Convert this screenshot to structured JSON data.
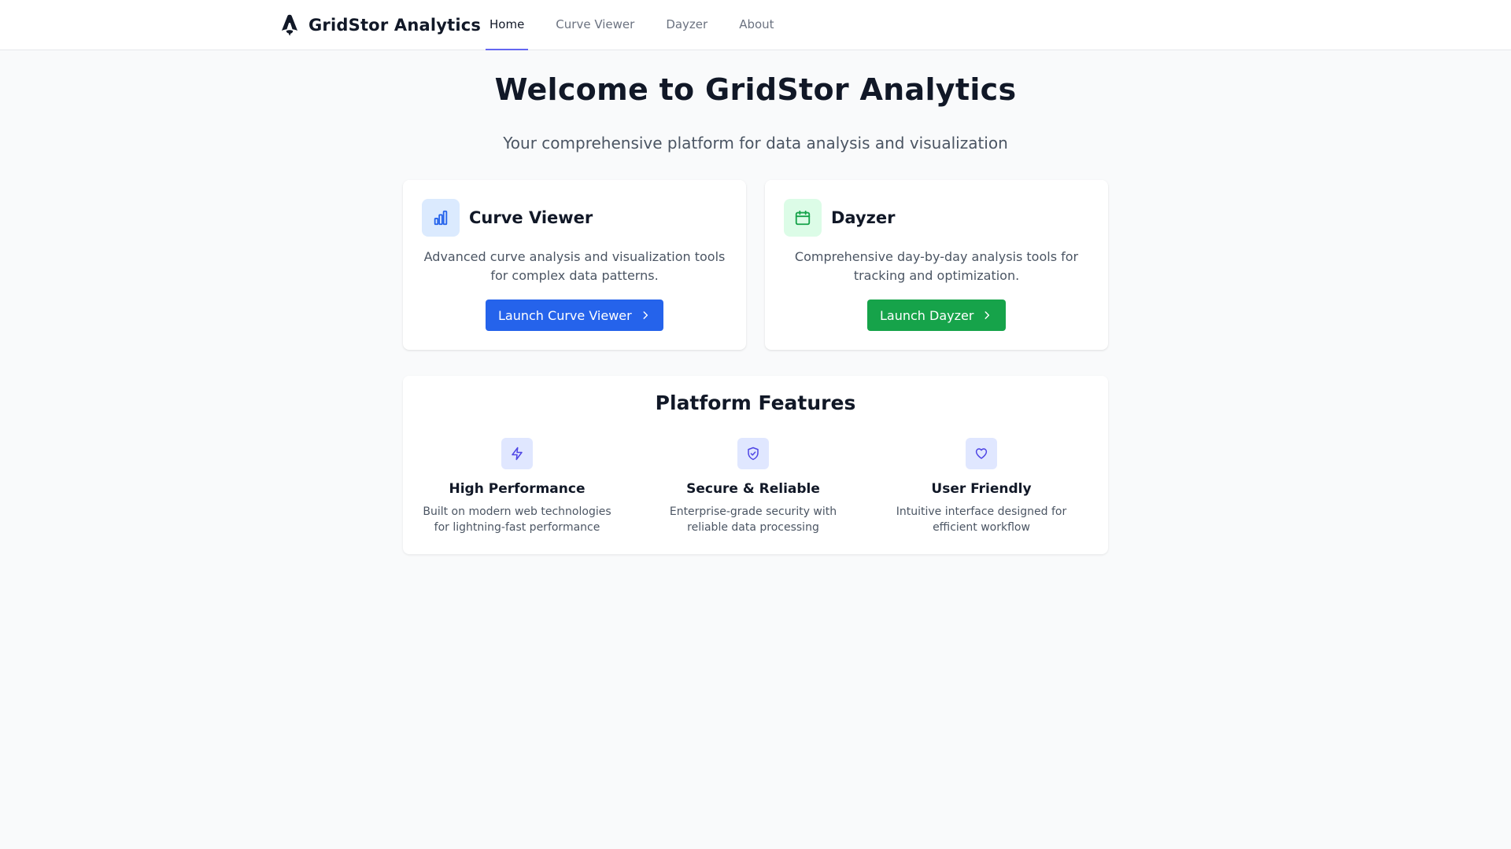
{
  "header": {
    "brand_name": "GridStor Analytics",
    "logo_icon": "astro-logo-icon",
    "tabs": [
      {
        "label": "Home",
        "active": true
      },
      {
        "label": "Curve Viewer",
        "active": false
      },
      {
        "label": "Dayzer",
        "active": false
      },
      {
        "label": "About",
        "active": false
      }
    ],
    "active_tab_color": "#6366f1"
  },
  "hero": {
    "title": "Welcome to GridStor Analytics",
    "subtitle": "Your comprehensive platform for data analysis and visualization"
  },
  "cards": [
    {
      "title": "Curve Viewer",
      "icon": "bar-chart-icon",
      "description": "Advanced curve analysis and visualization tools for complex data patterns.",
      "button_label": "Launch Curve Viewer",
      "accent": "#2563eb"
    },
    {
      "title": "Dayzer",
      "icon": "calendar-icon",
      "description": "Comprehensive day-by-day analysis tools for tracking and optimization.",
      "button_label": "Launch Dayzer",
      "accent": "#16a34a"
    }
  ],
  "features": {
    "title": "Platform Features",
    "items": [
      {
        "icon": "lightning-icon",
        "title": "High Performance",
        "description": "Built on modern web technologies for lightning-fast performance"
      },
      {
        "icon": "shield-check-icon",
        "title": "Secure & Reliable",
        "description": "Enterprise-grade security with reliable data processing"
      },
      {
        "icon": "heart-icon",
        "title": "User Friendly",
        "description": "Intuitive interface designed for efficient workflow"
      }
    ],
    "icon_color": "#4f46e5"
  }
}
